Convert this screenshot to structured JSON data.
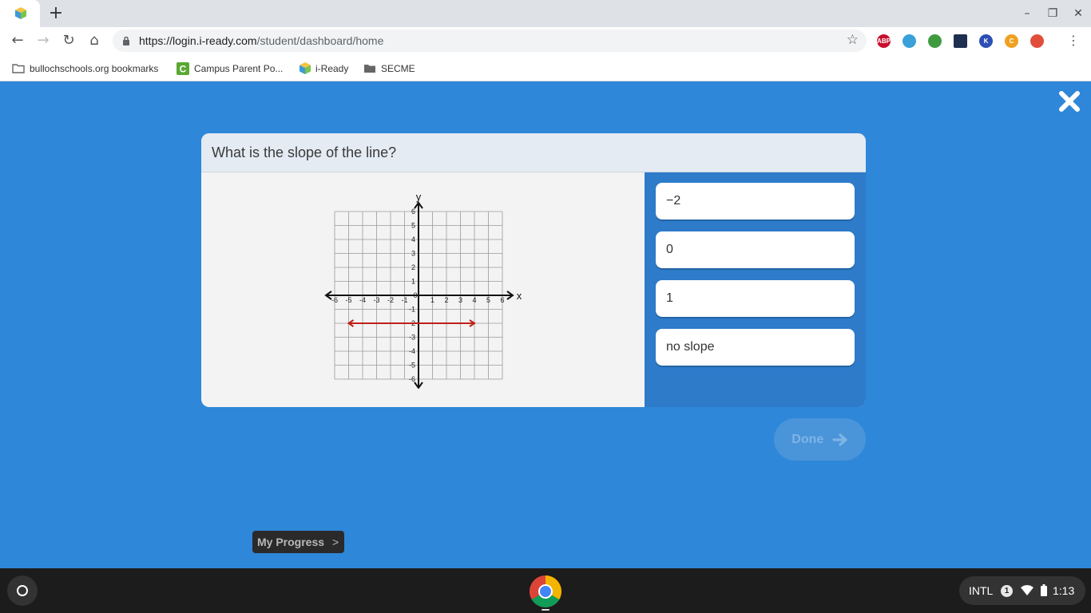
{
  "browser": {
    "new_tab_symbol": "+",
    "window_controls": {
      "minimize": "–",
      "restore": "❐",
      "close": "✕"
    },
    "nav": {
      "back": "←",
      "forward": "→",
      "reload": "↻",
      "home": "⌂"
    },
    "url_host": "https://login.i-ready.com",
    "url_path": "/student/dashboard/home",
    "star_icon": "☆",
    "menu_icon": "⋮",
    "extensions": [
      {
        "name": "abp-extension-icon",
        "label": "ABP",
        "color": "#c8102e"
      },
      {
        "name": "cloud-extension-icon",
        "label": "",
        "color": "#3aa0d8"
      },
      {
        "name": "power-extension-icon",
        "label": "",
        "color": "#3f9b3f"
      },
      {
        "name": "dark-extension-icon",
        "label": "",
        "color": "#1f2f4f"
      },
      {
        "name": "k-extension-icon",
        "label": "K",
        "color": "#2b4fb4"
      },
      {
        "name": "c-extension-icon",
        "label": "C",
        "color": "#f0a020"
      },
      {
        "name": "google-extension-icon",
        "label": "",
        "color": "#e04e3b"
      }
    ]
  },
  "bookmarks": [
    {
      "label": "bullochschools.org bookmarks",
      "icon": "folder-icon"
    },
    {
      "label": "Campus Parent Po...",
      "icon": "campus-icon"
    },
    {
      "label": "i-Ready",
      "icon": "iready-icon"
    },
    {
      "label": "SECME",
      "icon": "folder-icon"
    }
  ],
  "question": {
    "prompt": "What is the slope of the line?",
    "answers": [
      "−2",
      "0",
      "1",
      "no slope"
    ]
  },
  "chart_data": {
    "type": "line",
    "x_label": "x",
    "y_label": "y",
    "xlim": [
      -6,
      6
    ],
    "ylim": [
      -6,
      6
    ],
    "x_ticks": [
      "-6",
      "-5",
      "-4",
      "-3",
      "-2",
      "-1",
      "0",
      "1",
      "2",
      "3",
      "4",
      "5",
      "6"
    ],
    "y_ticks": [
      "6",
      "5",
      "4",
      "3",
      "2",
      "1",
      "-1",
      "-2",
      "-3",
      "-4",
      "-5",
      "-6"
    ],
    "grid": true,
    "series": [
      {
        "x": [
          -5,
          4
        ],
        "y": [
          -2,
          -2
        ],
        "color": "#c0201a",
        "arrows": "both"
      }
    ]
  },
  "done": {
    "label": "Done"
  },
  "progress": {
    "label": "My Progress",
    "chevron": ">"
  },
  "shelf": {
    "ime": "INTL",
    "notifications": "1",
    "time": "1:13"
  }
}
